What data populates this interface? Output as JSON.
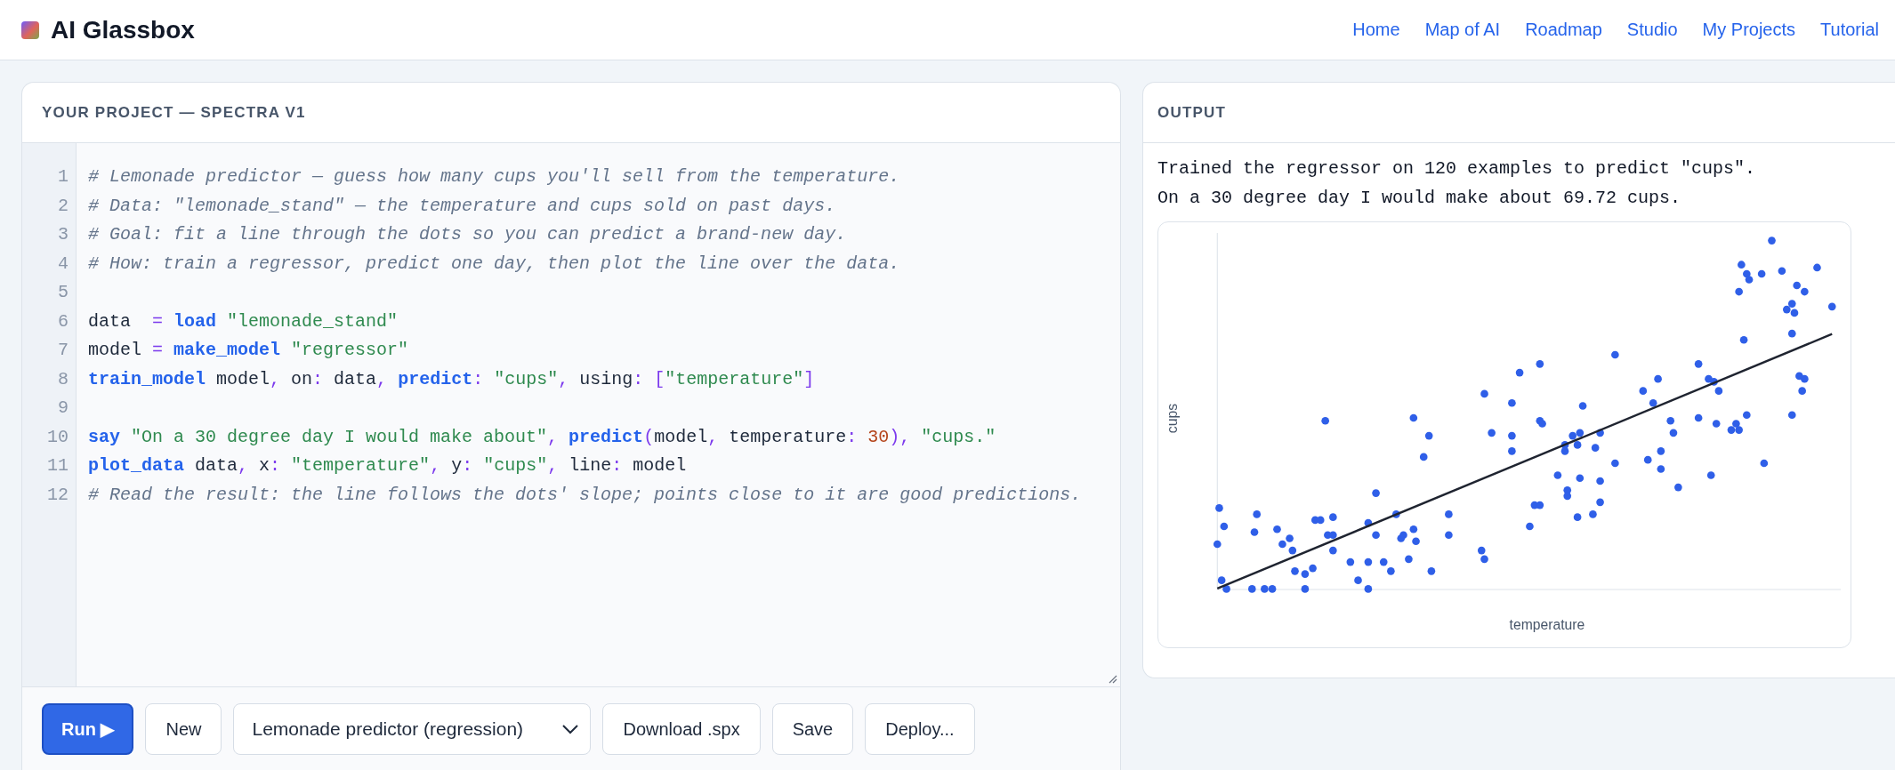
{
  "app": {
    "title": "AI Glassbox"
  },
  "nav": [
    "Home",
    "Map of AI",
    "Roadmap",
    "Studio",
    "My Projects",
    "Tutorial"
  ],
  "project_panel": {
    "title": "YOUR PROJECT — SPECTRA V1",
    "code_lines": [
      {
        "number": "1",
        "tokens": [
          {
            "kind": "comment",
            "text": "# Lemonade predictor — guess how many cups you'll sell from the temperature."
          }
        ]
      },
      {
        "number": "2",
        "tokens": [
          {
            "kind": "comment",
            "text": "# Data: \"lemonade_stand\" — the temperature and cups sold on past days."
          }
        ]
      },
      {
        "number": "3",
        "tokens": [
          {
            "kind": "comment",
            "text": "# Goal: fit a line through the dots so you can predict a brand-new day."
          }
        ]
      },
      {
        "number": "4",
        "tokens": [
          {
            "kind": "comment",
            "text": "# How: train a regressor, predict one day, then plot the line over the data."
          }
        ]
      },
      {
        "number": "5"
      },
      {
        "number": "6",
        "tokens": [
          {
            "kind": "plain",
            "text": "data  "
          },
          {
            "kind": "op",
            "text": "= "
          },
          {
            "kind": "keyword",
            "text": "load"
          },
          {
            "kind": "string",
            "text": " \"lemonade_stand\""
          }
        ]
      },
      {
        "number": "7",
        "tokens": [
          {
            "kind": "plain",
            "text": "model "
          },
          {
            "kind": "op",
            "text": "= "
          },
          {
            "kind": "keyword",
            "text": "make_model"
          },
          {
            "kind": "string",
            "text": " \"regressor\""
          }
        ]
      },
      {
        "number": "8",
        "tokens": [
          {
            "kind": "keyword",
            "text": "train_model"
          },
          {
            "kind": "plain",
            "text": " model"
          },
          {
            "kind": "op",
            "text": ","
          },
          {
            "kind": "plain",
            "text": " on"
          },
          {
            "kind": "op",
            "text": ":"
          },
          {
            "kind": "plain",
            "text": " data"
          },
          {
            "kind": "op",
            "text": ", "
          },
          {
            "kind": "keyword",
            "text": "predict"
          },
          {
            "kind": "op",
            "text": ":"
          },
          {
            "kind": "string",
            "text": " \"cups\""
          },
          {
            "kind": "op",
            "text": ","
          },
          {
            "kind": "plain",
            "text": " using"
          },
          {
            "kind": "op",
            "text": ": ["
          },
          {
            "kind": "string",
            "text": "\"temperature\""
          },
          {
            "kind": "op",
            "text": "]"
          }
        ]
      },
      {
        "number": "9"
      },
      {
        "number": "10",
        "tokens": [
          {
            "kind": "keyword",
            "text": "say"
          },
          {
            "kind": "string",
            "text": " \"On a 30 degree day I would make about\""
          },
          {
            "kind": "op",
            "text": ", "
          },
          {
            "kind": "keyword",
            "text": "predict"
          },
          {
            "kind": "op",
            "text": "("
          },
          {
            "kind": "plain",
            "text": "model"
          },
          {
            "kind": "op",
            "text": ","
          },
          {
            "kind": "plain",
            "text": " temperature"
          },
          {
            "kind": "op",
            "text": ": "
          },
          {
            "kind": "number",
            "text": "30"
          },
          {
            "kind": "op",
            "text": "),"
          },
          {
            "kind": "string",
            "text": " \"cups.\""
          }
        ]
      },
      {
        "number": "11",
        "tokens": [
          {
            "kind": "keyword",
            "text": "plot_data"
          },
          {
            "kind": "plain",
            "text": " data"
          },
          {
            "kind": "op",
            "text": ","
          },
          {
            "kind": "plain",
            "text": " x"
          },
          {
            "kind": "op",
            "text": ":"
          },
          {
            "kind": "string",
            "text": " \"temperature\""
          },
          {
            "kind": "op",
            "text": ","
          },
          {
            "kind": "plain",
            "text": " y"
          },
          {
            "kind": "op",
            "text": ":"
          },
          {
            "kind": "string",
            "text": " \"cups\""
          },
          {
            "kind": "op",
            "text": ","
          },
          {
            "kind": "plain",
            "text": " line"
          },
          {
            "kind": "op",
            "text": ":"
          },
          {
            "kind": "plain",
            "text": " model"
          }
        ]
      },
      {
        "number": "12",
        "tokens": [
          {
            "kind": "comment",
            "text": "# Read the result: the line follows the dots' slope; points close to it are good predictions."
          }
        ]
      }
    ],
    "toolbar": [
      {
        "kind": "primary",
        "label": "Run ▶"
      },
      {
        "kind": "button",
        "label": "New"
      },
      {
        "kind": "dropdown",
        "value": "Lemonade predictor (regression)"
      },
      {
        "kind": "button",
        "label": "Download .spx"
      },
      {
        "kind": "button",
        "label": "Save"
      },
      {
        "kind": "button",
        "label": "Deploy..."
      }
    ]
  },
  "output_panel": {
    "title": "OUTPUT",
    "lines": [
      "Trained the regressor on 120 examples to predict \"cups\".",
      "On a 30 degree day I would make about 69.72 cups."
    ],
    "plot": {
      "ylabel": "cups",
      "xlabel": "temperature"
    }
  }
}
